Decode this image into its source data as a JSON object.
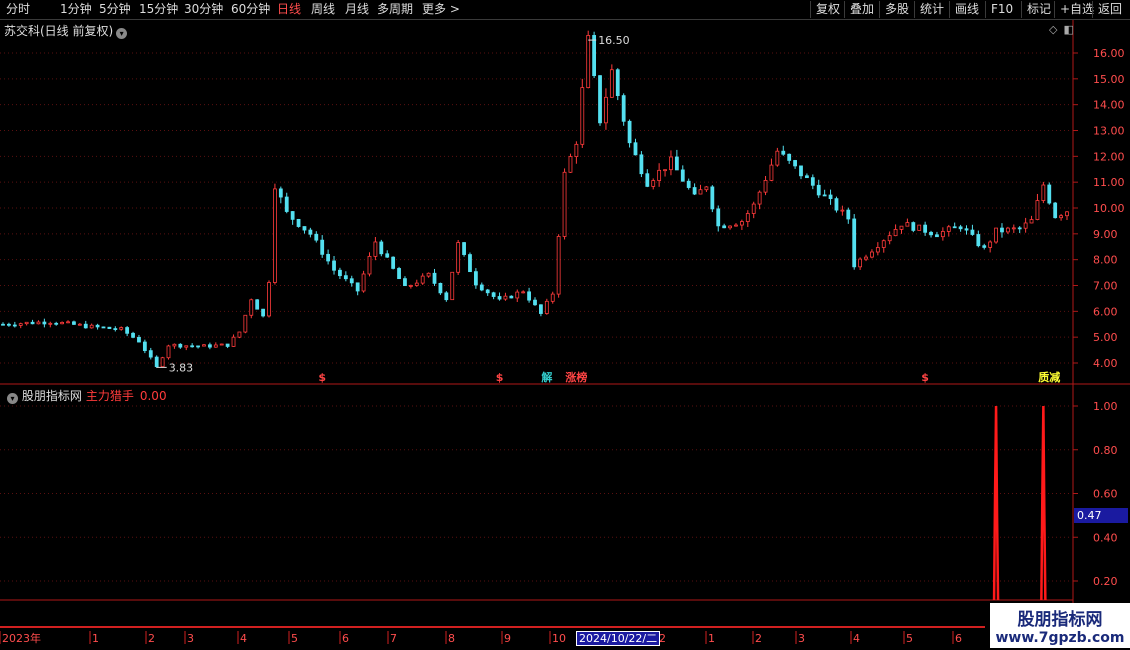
{
  "toolbar": {
    "left_tabs": [
      "分时",
      "1分钟",
      "5分钟",
      "15分钟",
      "30分钟",
      "60分钟",
      "日线",
      "周线",
      "月线",
      "多周期",
      "更多 >"
    ],
    "active_tab": "日线",
    "right_buttons": [
      "复权",
      "叠加",
      "多股",
      "统计",
      "画线",
      "F10",
      "标记",
      "+自选",
      "返回"
    ]
  },
  "main_chart": {
    "title": "苏交科(日线 前复权)",
    "high_label": "16.50",
    "low_label": "3.83",
    "y_ticks": [
      "16.00",
      "15.00",
      "14.00",
      "13.00",
      "12.00",
      "11.00",
      "10.00",
      "9.00",
      "8.00",
      "7.00",
      "6.00",
      "5.00",
      "4.00"
    ],
    "markers": [
      {
        "text": "$",
        "date_index": 54,
        "color": "#ff4444"
      },
      {
        "text": "$",
        "date_index": 84,
        "color": "#ff4444"
      },
      {
        "text": "解",
        "date_index": 92,
        "color": "#33cccc"
      },
      {
        "text": "涨榜",
        "date_index": 97,
        "color": "#ff4444"
      },
      {
        "text": "$",
        "date_index": 156,
        "color": "#ff4444"
      },
      {
        "text": "质减",
        "date_index": 177,
        "color": "#ffff33"
      }
    ]
  },
  "indicator": {
    "title": "股朋指标网",
    "name": "主力猎手",
    "value": "0.00",
    "y_ticks": [
      "1.00",
      "0.80",
      "0.60",
      "0.40",
      "0.20"
    ],
    "current_value": "0.47",
    "spikes": [
      {
        "date_index": 168,
        "value": 1.0
      },
      {
        "date_index": 176,
        "value": 1.0
      }
    ]
  },
  "timeline": {
    "labels": [
      "2023年",
      "1",
      "2",
      "3",
      "4",
      "5",
      "6",
      "7",
      "8",
      "9",
      "10",
      "2",
      "1",
      "2",
      "3",
      "4",
      "5",
      "6"
    ],
    "selected_date": "2024/10/22/二"
  },
  "icons": {
    "diamond": "diamond-icon",
    "panel": "panel-toggle-icon"
  },
  "watermark": {
    "line1": "股朋指标网",
    "line2": "www.7gpzb.com"
  },
  "chart_data": {
    "type": "candlestick",
    "title": "苏交科(日线 前复权)",
    "ylim": [
      3.5,
      16.8
    ],
    "up_color": "#ff3b3b",
    "down_color": "#54e0f0",
    "anchors": [
      [
        0,
        5.5
      ],
      [
        8,
        5.6
      ],
      [
        15,
        5.4
      ],
      [
        20,
        5.3
      ],
      [
        23,
        4.85
      ],
      [
        26,
        3.83
      ],
      [
        28,
        4.7
      ],
      [
        34,
        4.65
      ],
      [
        38,
        4.7
      ],
      [
        40,
        5.2
      ],
      [
        42,
        6.5
      ],
      [
        44,
        5.8
      ],
      [
        45,
        7.2
      ],
      [
        46,
        10.9
      ],
      [
        48,
        9.8
      ],
      [
        52,
        9.0
      ],
      [
        56,
        7.6
      ],
      [
        60,
        6.8
      ],
      [
        63,
        8.7
      ],
      [
        68,
        6.9
      ],
      [
        72,
        7.4
      ],
      [
        75,
        6.5
      ],
      [
        77,
        8.6
      ],
      [
        80,
        7.1
      ],
      [
        84,
        6.4
      ],
      [
        88,
        6.8
      ],
      [
        91,
        5.9
      ],
      [
        93,
        6.7
      ],
      [
        95,
        11.3
      ],
      [
        97,
        12.6
      ],
      [
        99,
        16.5
      ],
      [
        101,
        13.4
      ],
      [
        103,
        15.3
      ],
      [
        106,
        12.5
      ],
      [
        109,
        11.0
      ],
      [
        113,
        11.8
      ],
      [
        117,
        10.4
      ],
      [
        119,
        10.9
      ],
      [
        121,
        9.3
      ],
      [
        125,
        9.5
      ],
      [
        127,
        10.1
      ],
      [
        131,
        12.2
      ],
      [
        136,
        11.1
      ],
      [
        141,
        10.0
      ],
      [
        143,
        9.6
      ],
      [
        144,
        7.8
      ],
      [
        148,
        8.6
      ],
      [
        152,
        9.4
      ],
      [
        158,
        9.0
      ],
      [
        162,
        9.3
      ],
      [
        166,
        8.4
      ],
      [
        168,
        9.1
      ],
      [
        172,
        9.2
      ],
      [
        174,
        9.5
      ],
      [
        176,
        10.9
      ],
      [
        178,
        9.7
      ],
      [
        180,
        9.9
      ]
    ]
  }
}
